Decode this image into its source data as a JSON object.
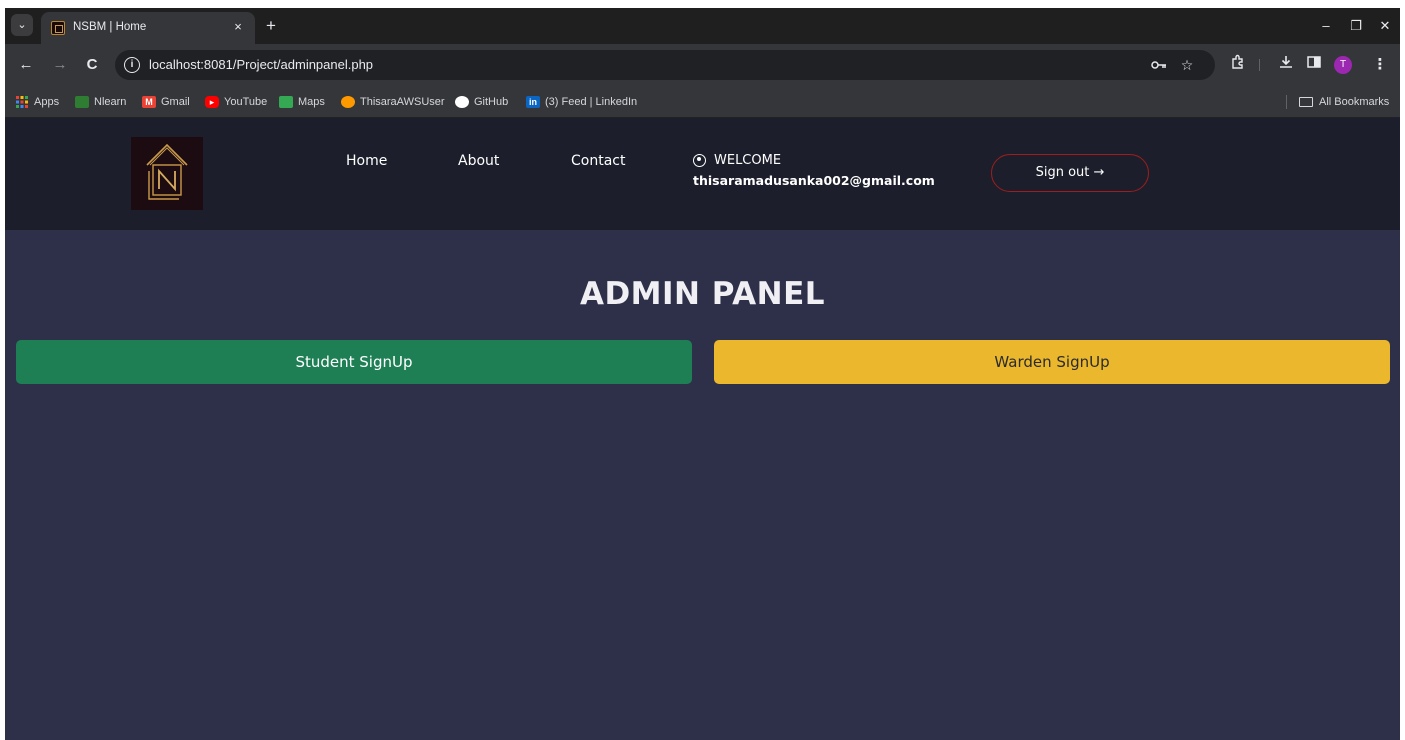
{
  "browser": {
    "tab": {
      "title": "NSBM | Home",
      "close": "×"
    },
    "new_tab": "+",
    "window_controls": {
      "minimize": "–",
      "restore": "❐",
      "close": "✕"
    },
    "tab_search": "⌄",
    "nav": {
      "back": "←",
      "forward": "→",
      "reload": "C"
    },
    "address": {
      "url": "localhost:8081/Project/adminpanel.php",
      "info": "i"
    },
    "omnibox_icons": [
      "key-icon",
      "star-icon"
    ],
    "toolbar_icons": [
      "extensions-icon",
      "download-icon",
      "side-panel-icon",
      "menu-icon"
    ],
    "profile_initial": "T",
    "bookmarks": [
      {
        "label": "Apps",
        "icon": "apps-grid-icon",
        "color": "#ea4335"
      },
      {
        "label": "Nlearn",
        "icon": "nlearn-icon",
        "color": "#2e7d32"
      },
      {
        "label": "Gmail",
        "icon": "gmail-icon",
        "color": "#ea4335"
      },
      {
        "label": "YouTube",
        "icon": "youtube-icon",
        "color": "#ff0000"
      },
      {
        "label": "Maps",
        "icon": "maps-icon",
        "color": "#34a853"
      },
      {
        "label": "ThisaraAWSUser",
        "icon": "aws-icon",
        "color": "#ff9900"
      },
      {
        "label": "GitHub",
        "icon": "github-icon",
        "color": "#ffffff"
      },
      {
        "label": "(3) Feed | LinkedIn",
        "icon": "linkedin-icon",
        "color": "#0a66c2"
      }
    ],
    "all_bookmarks": "All Bookmarks"
  },
  "header": {
    "nav": [
      "Home",
      "About",
      "Contact"
    ],
    "welcome": "WELCOME",
    "user_email": "thisaramadusanka002@gmail.com",
    "signout": "Sign out →"
  },
  "main": {
    "title": "ADMIN PANEL",
    "student_button": "Student SignUp",
    "warden_button": "Warden SignUp"
  },
  "colors": {
    "page_bg": "#2e3049",
    "header_bg": "#1c1f2b",
    "student_button": "#1e7f54",
    "warden_button": "#eab72d",
    "signout_border": "#a01d1d"
  }
}
